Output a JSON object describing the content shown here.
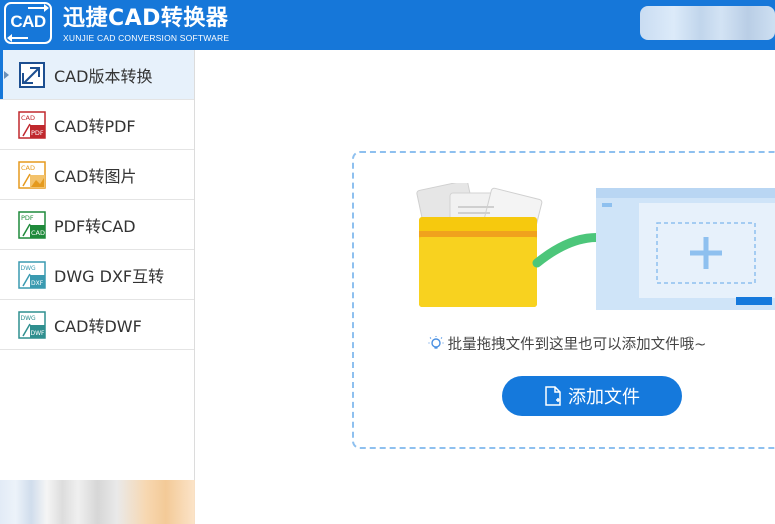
{
  "header": {
    "logo_text": "CAD",
    "title": "迅捷CAD转换器",
    "subtitle": "XUNJIE CAD CONVERSION SOFTWARE"
  },
  "sidebar": {
    "items": [
      {
        "label": "CAD版本转换",
        "icon": "cad-version-icon",
        "active": true
      },
      {
        "label": "CAD转PDF",
        "icon": "cad-to-pdf-icon",
        "active": false
      },
      {
        "label": "CAD转图片",
        "icon": "cad-to-image-icon",
        "active": false
      },
      {
        "label": "PDF转CAD",
        "icon": "pdf-to-cad-icon",
        "active": false
      },
      {
        "label": "DWG DXF互转",
        "icon": "dwg-dxf-icon",
        "active": false
      },
      {
        "label": "CAD转DWF",
        "icon": "cad-to-dwf-icon",
        "active": false
      }
    ]
  },
  "main": {
    "hint": "批量拖拽文件到这里也可以添加文件哦~",
    "add_button": "添加文件"
  },
  "icon_labels": {
    "cad": "CAD",
    "pdf": "PDF",
    "dwg": "DWG",
    "dxf": "DXF",
    "dwf": "DWF"
  },
  "colors": {
    "brand": "#1677d9",
    "pdf_red": "#c0282d",
    "image_orange": "#e59a1e",
    "pdf_to_cad_green": "#1f8a3b",
    "dwg_teal": "#3a9ab0",
    "dwf_teal": "#2f8f8f",
    "arrow_green": "#4cc67a",
    "folder_yellow": "#f6c90e"
  }
}
